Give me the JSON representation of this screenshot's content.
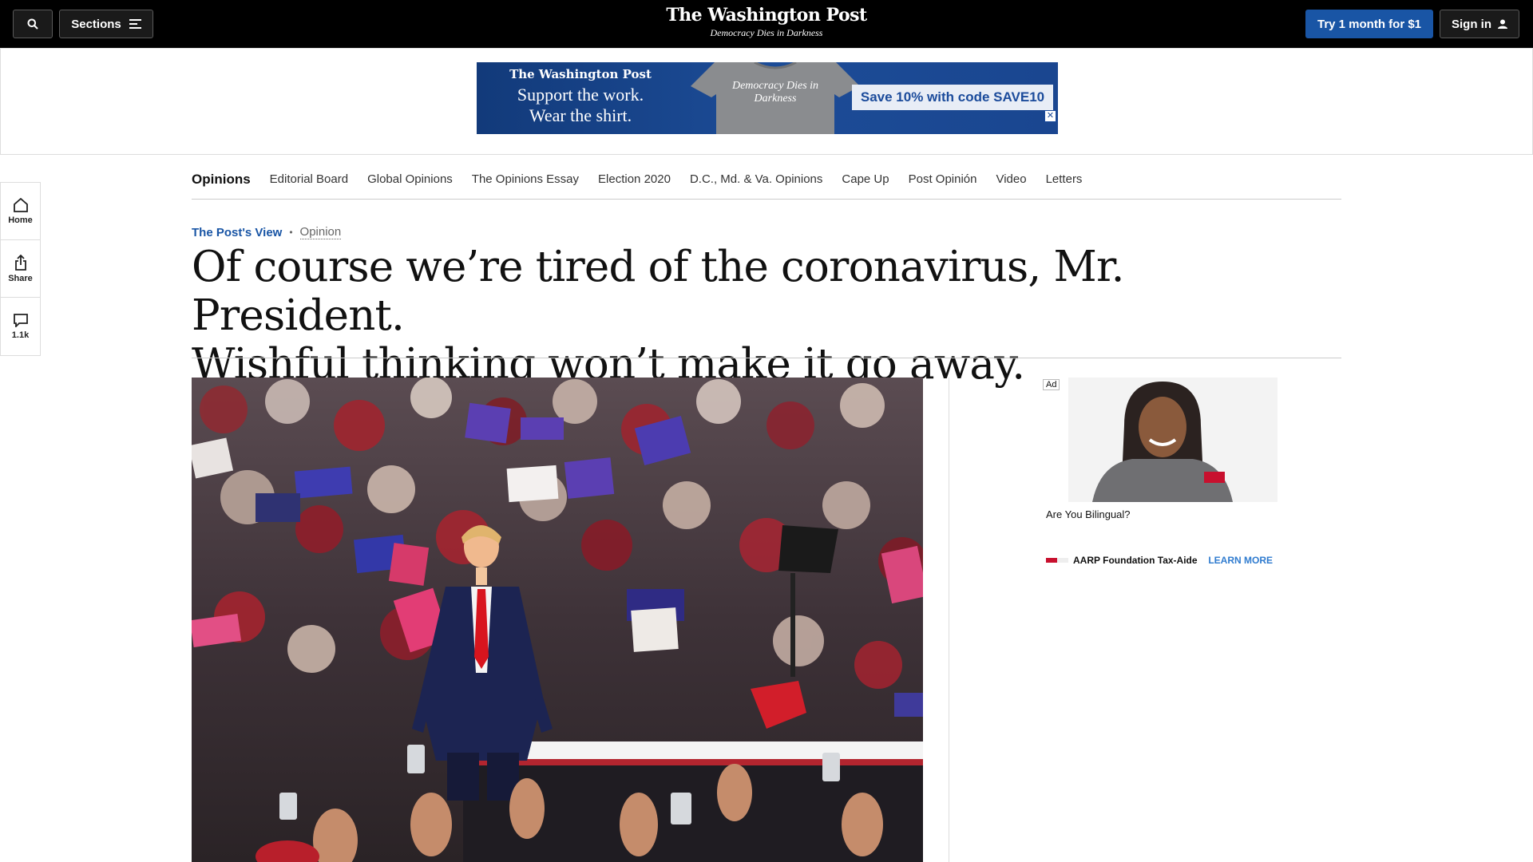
{
  "topbar": {
    "sections_label": "Sections",
    "logo": "The Washington Post",
    "tagline": "Democracy Dies in Darkness",
    "try_label": "Try 1 month for $1",
    "signin_label": "Sign in"
  },
  "promo": {
    "logo": "The Washington Post",
    "line1": "Support the work.",
    "line2": "Wear the shirt.",
    "shirt_text": "Democracy Dies in Darkness",
    "code_text": "Save 10% with code SAVE10",
    "close": "✕"
  },
  "rail": {
    "home": "Home",
    "share": "Share",
    "comments": "1.1k"
  },
  "secnav": {
    "items": [
      "Opinions",
      "Editorial Board",
      "Global Opinions",
      "The Opinions Essay",
      "Election 2020",
      "D.C., Md. & Va. Opinions",
      "Cape Up",
      "Post Opinión",
      "Video",
      "Letters"
    ]
  },
  "article": {
    "kicker_label": "The Post's View",
    "kicker_type": "Opinion",
    "headline_line1": "Of course we’re tired of the coronavirus, Mr. President.",
    "headline_line2": "Wishful thinking won’t make it go away."
  },
  "side_ad": {
    "badge": "Ad",
    "question": "Are You Bilingual?",
    "brand": "AARP Foundation Tax-Aide",
    "cta": "LEARN MORE",
    "close_a": "▷",
    "close_b": "✕"
  },
  "colors": {
    "accent": "#1955a5",
    "topbar": "#000000"
  }
}
